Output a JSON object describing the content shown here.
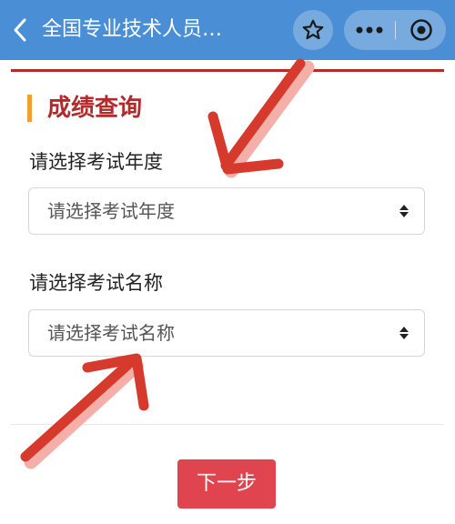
{
  "header": {
    "title": "全国专业技术人员…",
    "color": "#4a8fd6",
    "icons": [
      "chevron-left-icon",
      "star-outline-icon",
      "more-dots-icon",
      "target-circle-icon"
    ]
  },
  "section": {
    "title": "成绩查询",
    "title_color": "#b22a2a",
    "accent_color": "#f0a030"
  },
  "form": {
    "year": {
      "label": "请选择考试年度",
      "placeholder": "请选择考试年度"
    },
    "exam": {
      "label": "请选择考试名称",
      "placeholder": "请选择考试名称"
    }
  },
  "actions": {
    "next_label": "下一步",
    "next_color": "#e0444f"
  },
  "annotation_color": "#d63a2c"
}
